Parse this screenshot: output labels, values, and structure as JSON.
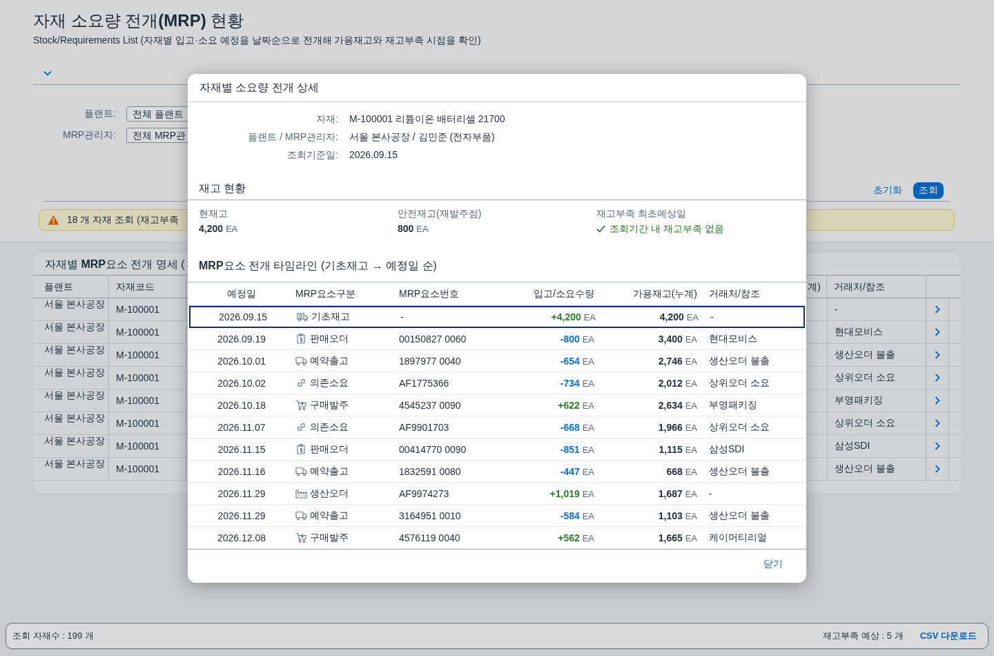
{
  "page": {
    "title": "자재 소요량 전개**(MRP)** 현황",
    "subtitle": "Stock/Requirements List (자재별 입고·소요 예정을 날짜순으로 전개해 가용재고와 재고부족 시점을 확인)"
  },
  "filters": [
    {
      "label": "플랜트:",
      "value": "전체 플랜트"
    },
    {
      "label": "MRP관리자:",
      "value": "전체 MRP관"
    }
  ],
  "actions": {
    "reset": "초기화",
    "search": "조회"
  },
  "message": {
    "kind": "warning",
    "text": "18 개 자재 조회 (재고부족"
  },
  "list": {
    "title": "자재별 **MRP**요소 전개 명세 (",
    "columns": [
      {
        "label": "플랜트"
      },
      {
        "label": "자재코드"
      },
      {
        "label": "계)"
      },
      {
        "label": "거래처/참조"
      }
    ],
    "rows": [
      {
        "plant": "서울 본사공장",
        "material": "M-100001",
        "partner": "-"
      },
      {
        "plant": "서울 본사공장",
        "material": "M-100001",
        "partner": "현대모비스"
      },
      {
        "plant": "서울 본사공장",
        "material": "M-100001",
        "partner": "생산오더 불출"
      },
      {
        "plant": "서울 본사공장",
        "material": "M-100001",
        "partner": "상위오더 소요"
      },
      {
        "plant": "서울 본사공장",
        "material": "M-100001",
        "partner": "부영패키징"
      },
      {
        "plant": "서울 본사공장",
        "material": "M-100001",
        "partner": "상위오더 소요"
      },
      {
        "plant": "서울 본사공장",
        "material": "M-100001",
        "partner": "삼성SDI"
      },
      {
        "plant": "서울 본사공장",
        "material": "M-100001",
        "partner": "생산오더 불출"
      }
    ]
  },
  "dialog": {
    "title": "자재별 소요량 전개 상세",
    "fields": [
      {
        "label": "자재:",
        "value": "M-100001 리튬이온 배터리셀 21700"
      },
      {
        "label": "플랜트 / MRP관리자:",
        "value": "서울 본사공장 / 김민준 (전자부품)"
      },
      {
        "label": "조회기준일:",
        "value": "2026.09.15"
      }
    ],
    "stock": {
      "title": "재고 현황",
      "items": [
        {
          "kind": "quantity",
          "label": "현재고",
          "value": "4,200",
          "unit": "EA"
        },
        {
          "kind": "quantity",
          "label": "안전재고(재발주점)",
          "value": "800",
          "unit": "EA"
        },
        {
          "kind": "status",
          "label": "재고부족 최초예상일",
          "ok": true,
          "text": "조회기간 내 재고부족 없음"
        }
      ]
    },
    "timeline": {
      "title": "**MRP**요소 전개 타임라인 (기초재고 → 예정일 순)",
      "columns": [
        {
          "label": "예정일"
        },
        {
          "label": "MRP요소구분"
        },
        {
          "label": "MRP요소번호"
        },
        {
          "label": "입고/소요수량"
        },
        {
          "label": "가용재고(누계)"
        },
        {
          "label": "거래처/참조"
        }
      ],
      "rows": [
        {
          "date": "2026.09.15",
          "kind": "stock",
          "type": "기초재고",
          "number": "-",
          "incoming": true,
          "qty": "+4,200",
          "qty_unit": "EA",
          "available": "4,200",
          "available_unit": "EA",
          "partner": "-",
          "selected": true
        },
        {
          "date": "2026.09.19",
          "kind": "sales",
          "type": "판매오더",
          "number": "00150827 0060",
          "incoming": false,
          "qty": "-800",
          "qty_unit": "EA",
          "available": "3,400",
          "available_unit": "EA",
          "partner": "현대모비스",
          "selected": false
        },
        {
          "date": "2026.10.01",
          "kind": "reservation",
          "type": "예약출고",
          "number": "1897977 0040",
          "incoming": false,
          "qty": "-654",
          "qty_unit": "EA",
          "available": "2,746",
          "available_unit": "EA",
          "partner": "생산오더 불출",
          "selected": false
        },
        {
          "date": "2026.10.02",
          "kind": "dependent",
          "type": "의존소요",
          "number": "AF1775366",
          "incoming": false,
          "qty": "-734",
          "qty_unit": "EA",
          "available": "2,012",
          "available_unit": "EA",
          "partner": "상위오더 소요",
          "selected": false
        },
        {
          "date": "2026.10.18",
          "kind": "purchase",
          "type": "구매발주",
          "number": "4545237 0090",
          "incoming": true,
          "qty": "+622",
          "qty_unit": "EA",
          "available": "2,634",
          "available_unit": "EA",
          "partner": "부영패키징",
          "selected": false
        },
        {
          "date": "2026.11.07",
          "kind": "dependent",
          "type": "의존소요",
          "number": "AF9901703",
          "incoming": false,
          "qty": "-668",
          "qty_unit": "EA",
          "available": "1,966",
          "available_unit": "EA",
          "partner": "상위오더 소요",
          "selected": false
        },
        {
          "date": "2026.11.15",
          "kind": "sales",
          "type": "판매오더",
          "number": "00414770 0090",
          "incoming": false,
          "qty": "-851",
          "qty_unit": "EA",
          "available": "1,115",
          "available_unit": "EA",
          "partner": "삼성SDI",
          "selected": false
        },
        {
          "date": "2026.11.16",
          "kind": "reservation",
          "type": "예약출고",
          "number": "1832591 0080",
          "incoming": false,
          "qty": "-447",
          "qty_unit": "EA",
          "available": "668",
          "available_unit": "EA",
          "partner": "생산오더 불출",
          "selected": false
        },
        {
          "date": "2026.11.29",
          "kind": "production",
          "type": "생산오더",
          "number": "AF9974273",
          "incoming": true,
          "qty": "+1,019",
          "qty_unit": "EA",
          "available": "1,687",
          "available_unit": "EA",
          "partner": "-",
          "selected": false
        },
        {
          "date": "2026.11.29",
          "kind": "reservation",
          "type": "예약출고",
          "number": "3164951 0010",
          "incoming": false,
          "qty": "-584",
          "qty_unit": "EA",
          "available": "1,103",
          "available_unit": "EA",
          "partner": "생산오더 불출",
          "selected": false
        },
        {
          "date": "2026.12.08",
          "kind": "purchase",
          "type": "구매발주",
          "number": "4576119 0040",
          "incoming": true,
          "qty": "+562",
          "qty_unit": "EA",
          "available": "1,665",
          "available_unit": "EA",
          "partner": "케이머티리얼",
          "selected": false
        }
      ]
    },
    "close": "닫기"
  },
  "status_bar": {
    "count": "조회 자재수 : 199 개",
    "shortage": "재고부족 예상 : 5 개",
    "csv": "CSV 다운로드"
  }
}
